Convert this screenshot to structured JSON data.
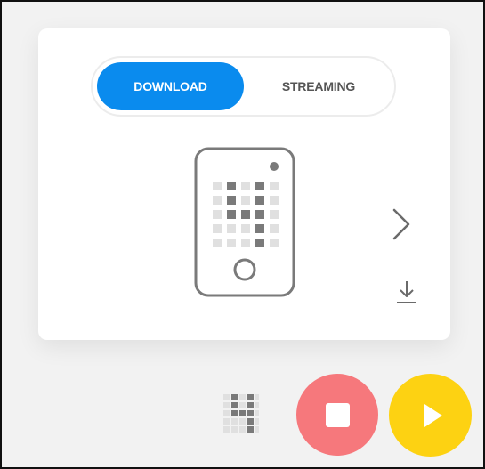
{
  "mode_toggle": {
    "options": [
      "DOWNLOAD",
      "STREAMING"
    ],
    "selected": "DOWNLOAD"
  },
  "device": {
    "icon": "microbit-phone-icon",
    "led_grid": [
      [
        0,
        1,
        0,
        1,
        0
      ],
      [
        0,
        1,
        0,
        1,
        0
      ],
      [
        0,
        1,
        1,
        1,
        0
      ],
      [
        0,
        0,
        0,
        1,
        0
      ],
      [
        0,
        0,
        0,
        1,
        0
      ]
    ]
  },
  "icons": {
    "next": "chevron-right-icon",
    "download": "download-icon",
    "stop": "stop-icon",
    "play": "play-icon"
  },
  "colors": {
    "accent": "#0a8bee",
    "stop": "#f6787c",
    "play": "#fdd212",
    "led_on": "#7a7a7a",
    "led_off": "#e0e0e0",
    "outline": "#7a7a7a"
  }
}
